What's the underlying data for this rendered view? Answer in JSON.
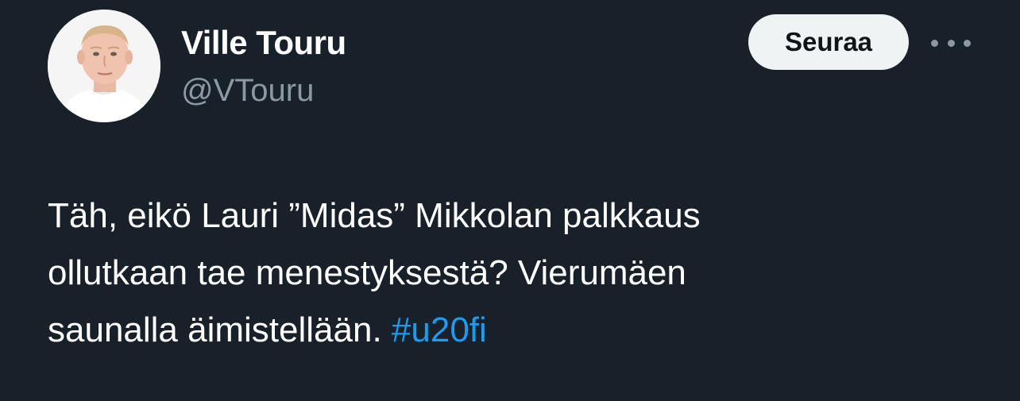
{
  "user": {
    "display_name": "Ville Touru",
    "handle": "@VTouru",
    "avatar_icon": "profile-photo"
  },
  "actions": {
    "follow_label": "Seuraa",
    "more_icon": "more-horizontal-icon"
  },
  "tweet": {
    "lines": [
      "Täh, eikö Lauri ”Midas” Mikkolan palkkaus",
      "ollutkaan tae menestyksestä? Vierumäen",
      "saunalla äimistellään."
    ],
    "hashtag": "#u20fi"
  },
  "colors": {
    "background": "#182029",
    "hashtag": "#1d9bf0",
    "secondary_text": "#8b98a5",
    "button_bg": "#eff3f4"
  }
}
